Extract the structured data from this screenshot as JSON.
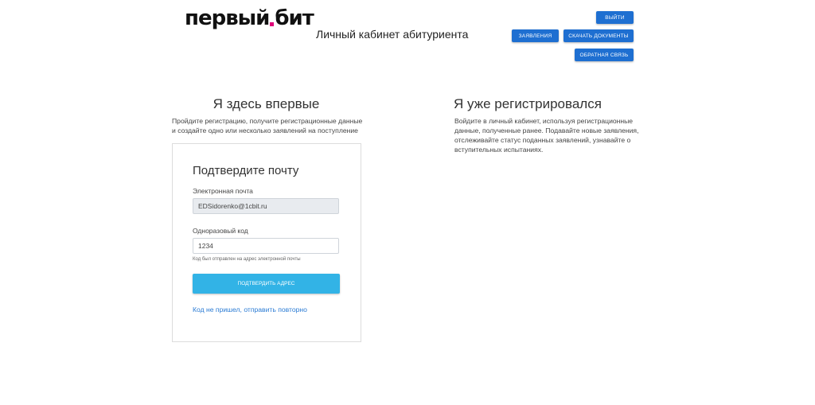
{
  "header": {
    "logo_left": "первый",
    "logo_right": "бит",
    "title": "Личный кабинет абитуриента",
    "buttons": {
      "logout": "Выйти",
      "applications": "Заявления",
      "download_docs": "Скачать документы",
      "feedback": "Обратная связь"
    }
  },
  "left": {
    "heading": "Я здесь впервые",
    "description": "Пройдите регистрацию, получите регистрационные данные и создайте одно или несколько заявлений на поступление",
    "card": {
      "title": "Подтвердите почту",
      "email_label": "Электронная почта",
      "email_value": "EDSidorenko@1cbit.ru",
      "code_label": "Одноразовый код",
      "code_value": "1234",
      "hint": "Код был отправлен на адрес электронной почты",
      "confirm_button": "Подтвердить адрес",
      "resend_link": "Код не пришел, отправить повторно"
    }
  },
  "right": {
    "heading": "Я уже регистрировался",
    "description": "Войдите в личный кабинет, используя регистрационные данные, полученные ранее. Подавайте новые заявления, отслеживайте статус поданных заявлений, узнавайте о вступительных испытаниях."
  },
  "colors": {
    "primary_button": "#1e6fd1",
    "confirm_button": "#32b3e6",
    "link": "#2a7bd4",
    "logo_accent": "#e0007a"
  }
}
